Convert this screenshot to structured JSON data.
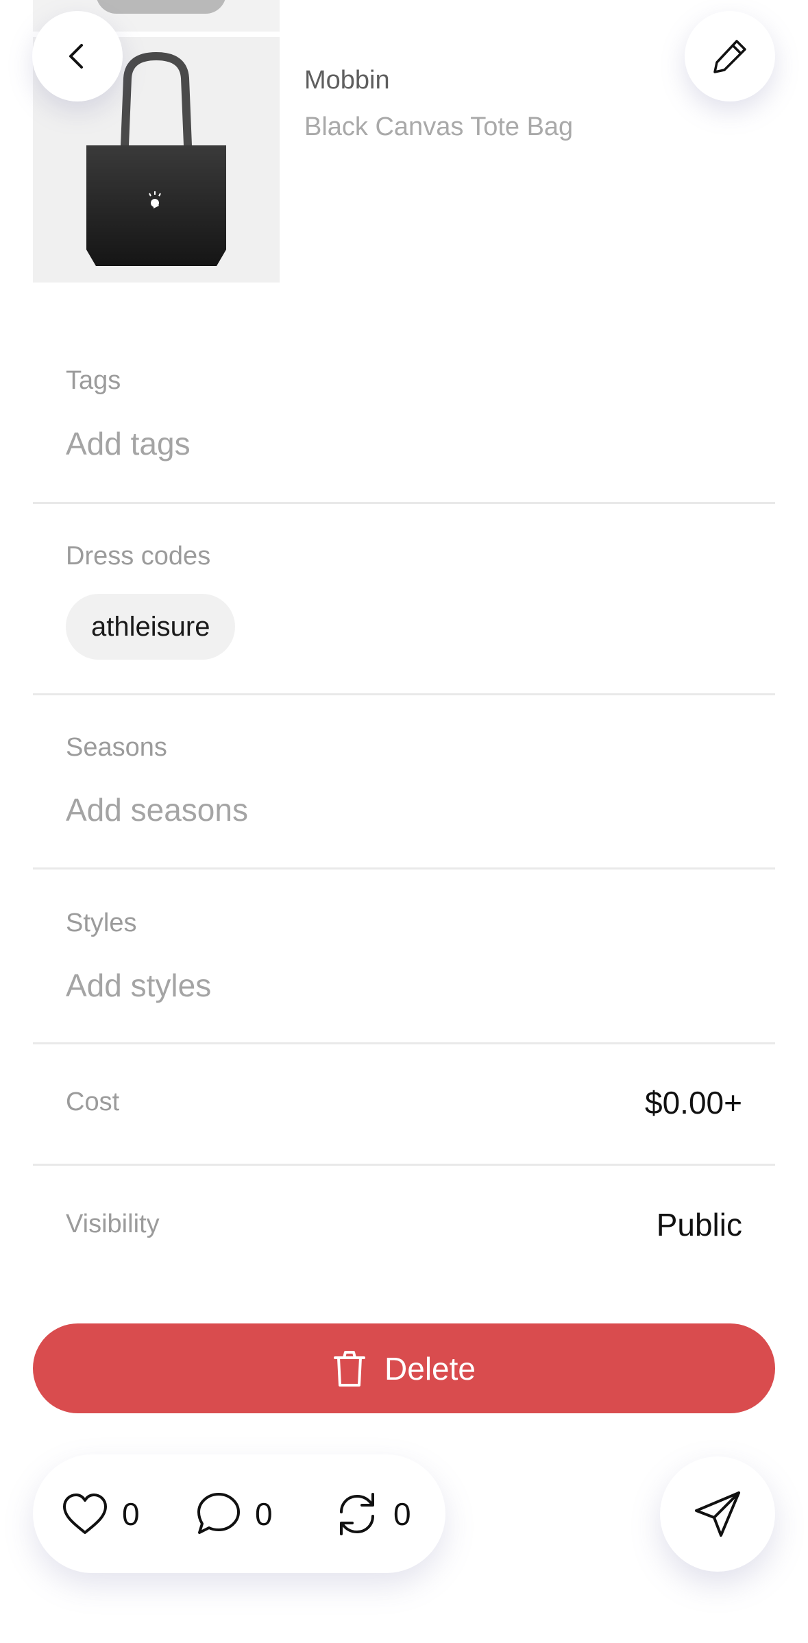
{
  "product": {
    "brand": "Mobbin",
    "name": "Black Canvas Tote Bag"
  },
  "details": {
    "tags": {
      "label": "Tags",
      "placeholder": "Add tags"
    },
    "dress_codes": {
      "label": "Dress codes",
      "chips": [
        "athleisure"
      ]
    },
    "seasons": {
      "label": "Seasons",
      "placeholder": "Add seasons"
    },
    "styles": {
      "label": "Styles",
      "placeholder": "Add styles"
    },
    "cost": {
      "label": "Cost",
      "value": "$0.00+"
    },
    "visibility": {
      "label": "Visibility",
      "value": "Public"
    }
  },
  "actions": {
    "delete_label": "Delete"
  },
  "engagement": {
    "likes": "0",
    "comments": "0",
    "reposts": "0"
  },
  "icons": {
    "back": "chevron-left-icon",
    "edit": "pencil-icon",
    "delete": "trash-icon",
    "like": "heart-icon",
    "comment": "comment-icon",
    "repost": "repost-icon",
    "share": "send-icon"
  },
  "colors": {
    "delete_button": "#d94c4e",
    "label_gray": "#9b9b9b",
    "placeholder_gray": "#a4a4a4",
    "text_dark": "#111111"
  }
}
